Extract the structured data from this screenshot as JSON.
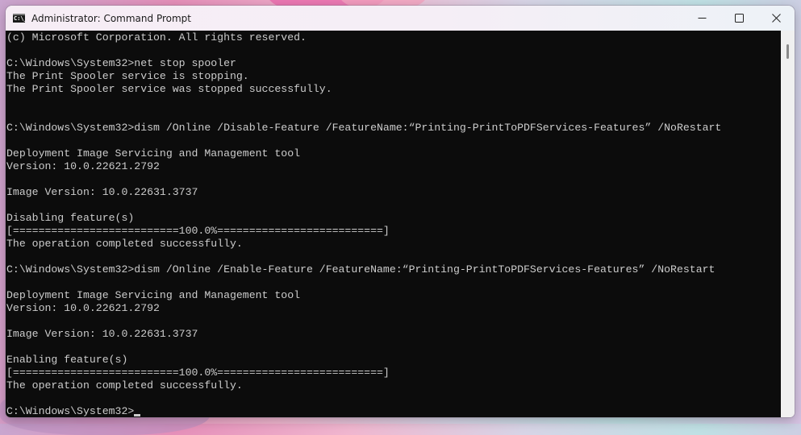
{
  "window": {
    "title": "Administrator: Command Prompt",
    "icon": "cmd-icon",
    "icon_text": "C:\\_",
    "controls": [
      {
        "name": "minimize",
        "icon": "minimize-icon"
      },
      {
        "name": "maximize",
        "icon": "maximize-icon"
      },
      {
        "name": "close",
        "icon": "close-icon"
      }
    ]
  },
  "console": {
    "lines": [
      "(c) Microsoft Corporation. All rights reserved.",
      "",
      "C:\\Windows\\System32>net stop spooler",
      "The Print Spooler service is stopping.",
      "The Print Spooler service was stopped successfully.",
      "",
      "",
      "C:\\Windows\\System32>dism /Online /Disable-Feature /FeatureName:“Printing-PrintToPDFServices-Features” /NoRestart",
      "",
      "Deployment Image Servicing and Management tool",
      "Version: 10.0.22621.2792",
      "",
      "Image Version: 10.0.22631.3737",
      "",
      "Disabling feature(s)",
      "[==========================100.0%==========================]",
      "The operation completed successfully.",
      "",
      "C:\\Windows\\System32>dism /Online /Enable-Feature /FeatureName:“Printing-PrintToPDFServices-Features” /NoRestart",
      "",
      "Deployment Image Servicing and Management tool",
      "Version: 10.0.22621.2792",
      "",
      "Image Version: 10.0.22631.3737",
      "",
      "Enabling feature(s)",
      "[==========================100.0%==========================]",
      "The operation completed successfully.",
      "",
      "C:\\Windows\\System32>"
    ],
    "prompt": "C:\\Windows\\System32>",
    "disable_progress_percent": 100.0,
    "enable_progress_percent": 100.0
  },
  "colors": {
    "console_bg": "#0c0c0c",
    "console_fg": "#cccccc"
  }
}
